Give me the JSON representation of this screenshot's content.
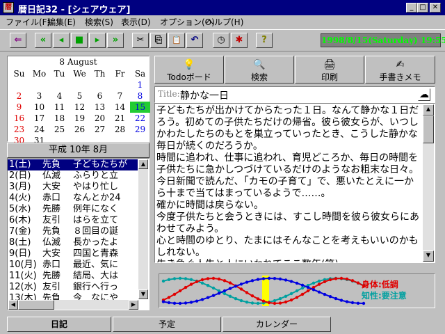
{
  "window": {
    "title": "暦日記32 - [シェアウェア]",
    "icon_glyph": "暦"
  },
  "window_buttons": {
    "minimize": "_",
    "maximize": "□",
    "close": "✕"
  },
  "menu": [
    "ファイル(F)",
    "編集(E)",
    "検索(S)",
    "表示(D)",
    "オプション(O)",
    "ヘルプ(H)"
  ],
  "toolbar": {
    "exit_icon": "⇐",
    "first_icon": "«",
    "prev_icon": "◂",
    "stop_icon": "■",
    "next_icon": "▸",
    "last_icon": "»",
    "cut_icon": "✂",
    "copy_icon": "⎘",
    "paste_icon": "📋",
    "undo_icon": "↶",
    "clock_icon": "◷",
    "alarm_icon": "✱",
    "help_icon": "?"
  },
  "datetime": "1998/8/15(Saturday) 19:55",
  "calendar": {
    "title": "8 August",
    "weekdays": [
      "Su",
      "Mo",
      "Tu",
      "We",
      "Th",
      "Fr",
      "Sa"
    ],
    "weeks": [
      [
        "",
        "",
        "",
        "",
        "",
        "",
        "1"
      ],
      [
        "2",
        "3",
        "4",
        "5",
        "6",
        "7",
        "8"
      ],
      [
        "9",
        "10",
        "11",
        "12",
        "13",
        "14",
        "15"
      ],
      [
        "16",
        "17",
        "18",
        "19",
        "20",
        "21",
        "22"
      ],
      [
        "23",
        "24",
        "25",
        "26",
        "27",
        "28",
        "29"
      ],
      [
        "30",
        "31",
        "",
        "",
        "",
        "",
        ""
      ]
    ],
    "today": "15"
  },
  "diary": {
    "month_header": "平成 10年 8月",
    "rows": [
      {
        "date": "1(土)",
        "rokuyo": "先負",
        "title": "子どもたちが"
      },
      {
        "date": "2(日)",
        "rokuyo": "仏滅",
        "title": "ふらりと立"
      },
      {
        "date": "3(月)",
        "rokuyo": "大安",
        "title": "やはり忙し"
      },
      {
        "date": "4(火)",
        "rokuyo": "赤口",
        "title": "なんとか24"
      },
      {
        "date": "5(水)",
        "rokuyo": "先勝",
        "title": "例年になく"
      },
      {
        "date": "6(木)",
        "rokuyo": "友引",
        "title": "はらを立て"
      },
      {
        "date": "7(金)",
        "rokuyo": "先負",
        "title": "８回目の誕"
      },
      {
        "date": "8(土)",
        "rokuyo": "仏滅",
        "title": "長かったよ"
      },
      {
        "date": "9(日)",
        "rokuyo": "大安",
        "title": "四国と青森"
      },
      {
        "date": "10(月)",
        "rokuyo": "赤口",
        "title": "最近、気に"
      },
      {
        "date": "11(火)",
        "rokuyo": "先勝",
        "title": "結局、大は"
      },
      {
        "date": "12(水)",
        "rokuyo": "友引",
        "title": "銀行へ行っ"
      },
      {
        "date": "13(木)",
        "rokuyo": "先負",
        "title": "今　なにや"
      }
    ],
    "selected_index": 0
  },
  "scroll": {
    "up": "▲",
    "down": "▼",
    "left": "◀",
    "right": "▶"
  },
  "actions": [
    {
      "label": "Todoボード",
      "icon": "💡"
    },
    {
      "label": "検索",
      "icon": "🔍"
    },
    {
      "label": "印刷",
      "icon": "🖨"
    },
    {
      "label": "手書きメモ",
      "icon": "✍"
    }
  ],
  "entry": {
    "title_label": "Title:",
    "title_value": "静かな一日",
    "body": "子どもたちが出かけてからたった１日。なんて静かな１日だろう。初めての子供たちだけの帰省。彼ら彼女らが、いつしかわたしたちのもとを巣立っていったとき、こうした静かな毎日が続くのだろうか。\n時間に追われ、仕事に追われ、育児どころか、毎日の時間を子供たちに急かしつづけているだけのようなお粗末な日々。今日新聞で読んだ、「カモの子育て」で、悪いたとえに一から十まで当てはまっているようで……。\n確かに時間は戻らない。\n今度子供たちと会うときには、すこし時間を彼ら彼女らにあわせてみよう。\n心と時間のゆとり、たまにはそんなことを考えもいいのかもしれない。\n生き急ぐ人生と人にいわれてここ数年(笑)"
  },
  "biorhythm": {
    "body_label": "身体:低調",
    "mind_label": "知性:要注意",
    "colors": {
      "body": "#e00000",
      "mind": "#0000e0",
      "emotion": "#00a0a0",
      "today": "#ffff00"
    }
  },
  "tabs": [
    {
      "label": "日記",
      "active": true
    },
    {
      "label": "予定",
      "active": false
    },
    {
      "label": "カレンダー",
      "active": false
    }
  ]
}
